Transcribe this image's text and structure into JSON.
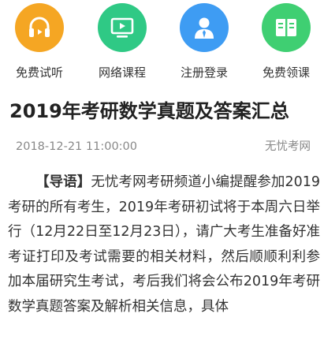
{
  "nav": [
    {
      "label": "免费试听",
      "icon": "headphones-icon",
      "color": "#f5a623"
    },
    {
      "label": "网络课程",
      "icon": "video-screen-icon",
      "color": "#2fc985"
    },
    {
      "label": "注册登录",
      "icon": "user-icon",
      "color": "#3e9cf3"
    },
    {
      "label": "免费领课",
      "icon": "book-icon",
      "color": "#3fcf72"
    }
  ],
  "article": {
    "title": "2019年考研数学真题及答案汇总",
    "date": "2018-12-21 11:00:00",
    "source": "无忧考网",
    "lead": "【导语】",
    "body": "无忧考网考研频道小编提醒参加2019考研的所有考生，2019年考研初试将于本周六日举行（12月22日至12月23日），请广大考生准备好准考证打印及考试需要的相关材料，然后顺顺利利参加本届研究生考试，考后我们将会公布2019年考研数学真题答案及解析相关信息，具体"
  }
}
